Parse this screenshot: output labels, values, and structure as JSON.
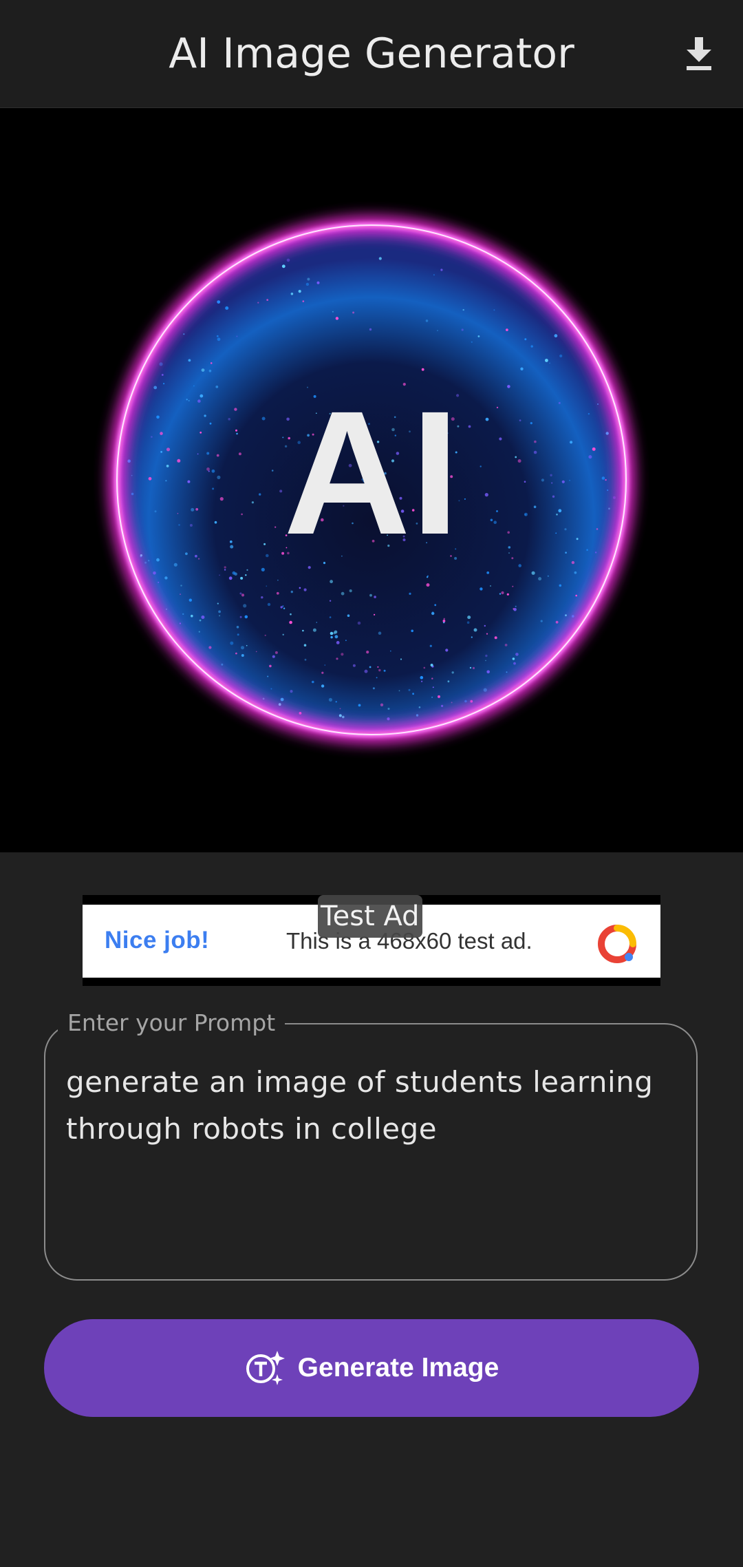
{
  "appbar": {
    "title": "AI Image Generator",
    "download_icon": "download-icon"
  },
  "hero": {
    "text": "AI",
    "ring_color": "#ff3cf0",
    "particle_color": "#1e8fff"
  },
  "ad": {
    "badge": "Test Ad",
    "headline": "Nice job!",
    "message": "This is a 468x60 test ad.",
    "logo_icon": "ad-logo-icon"
  },
  "prompt": {
    "label": "Enter your Prompt",
    "value": "generate an image of students learning\nthrough robots in college"
  },
  "generate": {
    "label": "Generate Image",
    "icon": "text-sparkle-icon",
    "color": "#6e41b9"
  }
}
